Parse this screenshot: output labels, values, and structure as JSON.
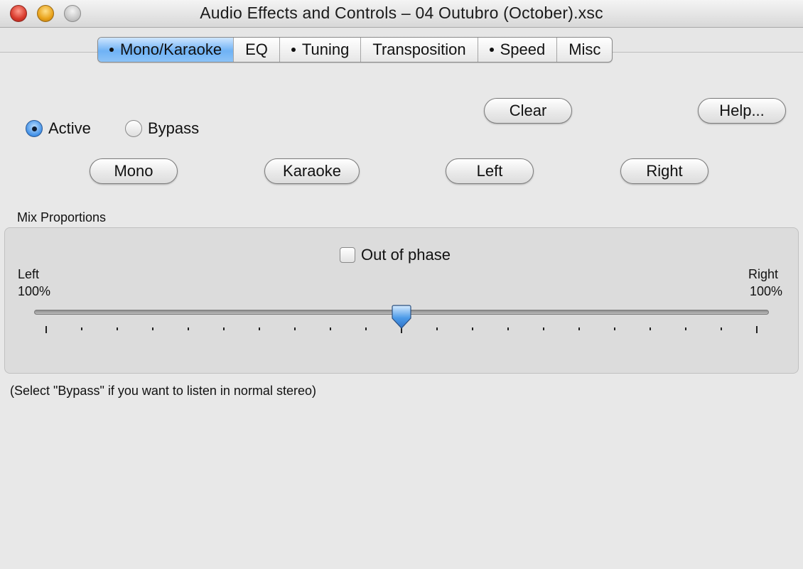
{
  "window": {
    "title": "Audio Effects and Controls – 04 Outubro (October).xsc"
  },
  "tabs": [
    {
      "label": "Mono/Karaoke",
      "dot": true,
      "selected": true
    },
    {
      "label": "EQ",
      "dot": false,
      "selected": false
    },
    {
      "label": "Tuning",
      "dot": true,
      "selected": false
    },
    {
      "label": "Transposition",
      "dot": false,
      "selected": false
    },
    {
      "label": "Speed",
      "dot": true,
      "selected": false
    },
    {
      "label": "Misc",
      "dot": false,
      "selected": false
    }
  ],
  "mode": {
    "active_label": "Active",
    "bypass_label": "Bypass",
    "selected": "Active"
  },
  "buttons": {
    "clear": "Clear",
    "help": "Help...",
    "mono": "Mono",
    "karaoke": "Karaoke",
    "left": "Left",
    "right": "Right"
  },
  "mix": {
    "section_label": "Mix Proportions",
    "out_of_phase_label": "Out of phase",
    "out_of_phase_checked": false,
    "left_label": "Left",
    "left_value": "100%",
    "right_label": "Right",
    "right_value": "100%",
    "slider_fraction": 0.5
  },
  "note": "(Select \"Bypass\" if you want to listen in normal stereo)",
  "colors": {
    "selected_tab": "#6fb2f5",
    "radio_on": "#3f8fe6",
    "slider_thumb": "#4c9ae8"
  }
}
